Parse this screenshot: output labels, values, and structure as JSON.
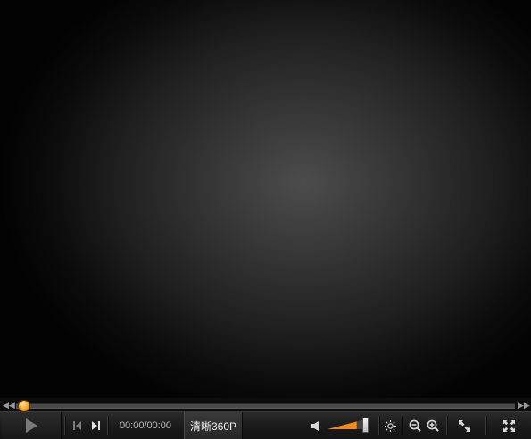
{
  "player": {
    "time_display": "00:00/00:00",
    "quality_label": "清晰360P",
    "progress_fraction": 0.0,
    "volume_fraction": 0.78,
    "accent_color": "#f28a1d"
  },
  "icons": {
    "seek_back": "rewind-icon",
    "seek_forward": "fast-forward-icon",
    "play": "play-icon",
    "prev": "skip-previous-icon",
    "next": "skip-next-icon",
    "volume": "speaker-icon",
    "brightness": "brightness-icon",
    "zoom_out": "zoom-out-icon",
    "zoom_in": "zoom-in-icon",
    "expand": "expand-icon",
    "fullscreen": "fullscreen-icon"
  }
}
